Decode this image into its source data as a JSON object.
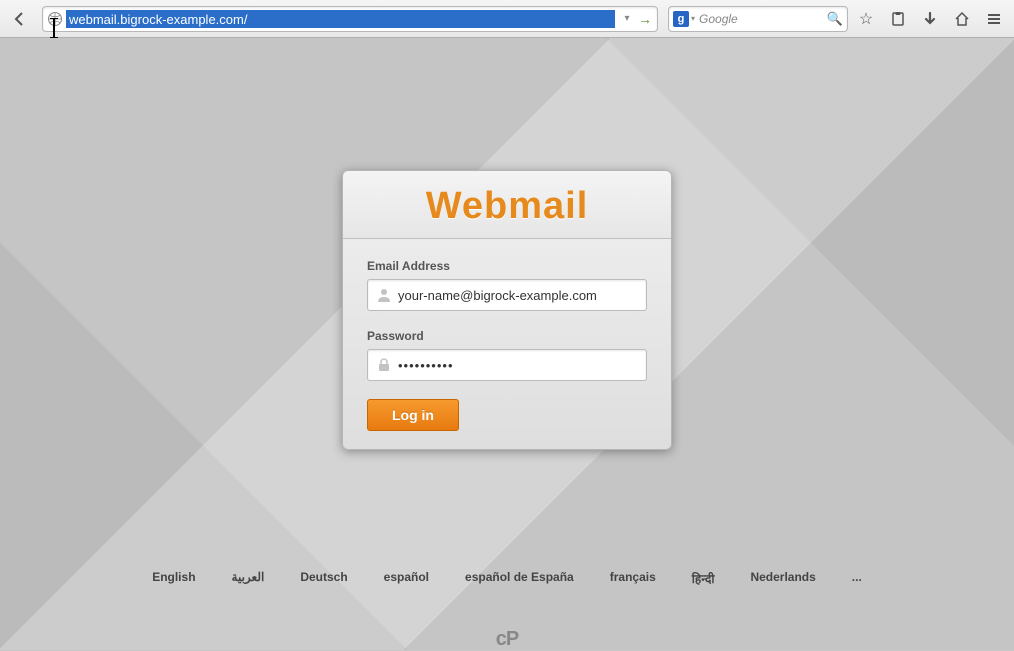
{
  "browser": {
    "url": "webmail.bigrock-example.com/",
    "search_placeholder": "Google",
    "search_engine_badge": "g"
  },
  "login": {
    "title": "Webmail",
    "email_label": "Email Address",
    "email_value": "your-name@bigrock-example.com",
    "password_label": "Password",
    "password_value": "••••••••••",
    "login_button": "Log in"
  },
  "languages": [
    "English",
    "العربية",
    "Deutsch",
    "español",
    "español de España",
    "français",
    "हिन्दी",
    "Nederlands",
    "..."
  ],
  "footer_logo": "cP"
}
